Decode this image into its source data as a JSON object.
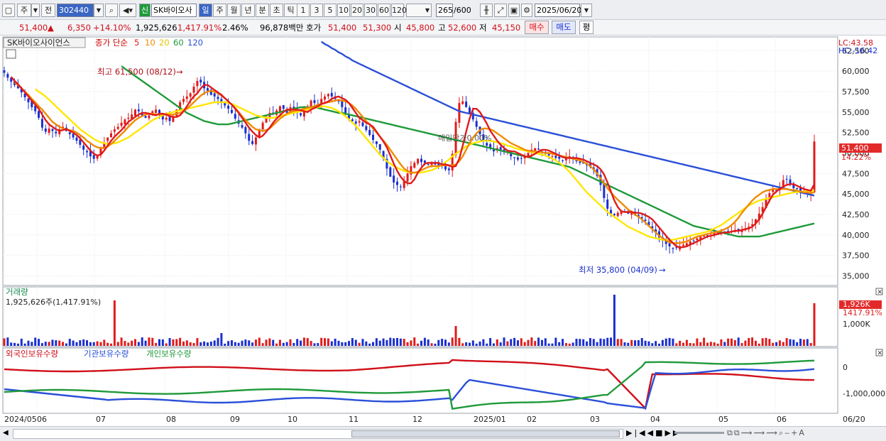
{
  "toolbar": {
    "period_unit": "주",
    "prev": "전",
    "code": "302440",
    "name": "SK바이오사",
    "new_badge": "신",
    "periods": [
      "일",
      "주",
      "월",
      "년",
      "분",
      "초",
      "틱"
    ],
    "intervals": [
      "1",
      "3",
      "5",
      "10",
      "20",
      "30",
      "60",
      "120"
    ],
    "count": "265",
    "total": "/600",
    "date": "2025/06/20"
  },
  "price_bar": {
    "price": "51,400",
    "arrow": "▲",
    "change": "6,350",
    "change_pct": "+14.10%",
    "volume": "1,925,626",
    "volume_pct": "1,417.91%",
    "turnover": "2.46%",
    "amount": "96,878백만",
    "bid_ask_label": "호가",
    "ask": "51,400",
    "bid": "51,300",
    "open_label": "시",
    "open": "45,800",
    "high_label": "고",
    "high": "52,600",
    "low_label": "저",
    "low": "45,150",
    "buy": "매수",
    "sell": "매도",
    "eval": "평"
  },
  "legend": {
    "title": "SK바이오사이언스",
    "price_label": "종가 단순",
    "ma": [
      {
        "label": "5",
        "color": "#e01b1b"
      },
      {
        "label": "10",
        "color": "#f08a00"
      },
      {
        "label": "20",
        "color": "#ffe600"
      },
      {
        "label": "60",
        "color": "#1f9a3a"
      },
      {
        "label": "120",
        "color": "#2a4fd8"
      }
    ],
    "lc": "LC:43.58",
    "hc": "HC:-16.42"
  },
  "annotations": {
    "high": "최고 61,500 (08/12)",
    "low": "최저 35,800 (04/09)",
    "mid": "매입단가0.00%"
  },
  "last_price_tag": {
    "price": "51,400",
    "pct": "14.22%"
  },
  "volume_panel": {
    "title": "거래량",
    "value": "1,925,626주(1,417.91%)",
    "tag": "1,926K",
    "tag_pct": "1417.91%",
    "tick": "1,000K"
  },
  "holdings_panel": {
    "labels": [
      "외국인보유수량",
      "기관보유수량",
      "개인보유수량"
    ],
    "colors": [
      "#d0101a",
      "#2a4fd8",
      "#1f9a3a"
    ],
    "ticks": [
      "0",
      "-1,000,000"
    ]
  },
  "x_labels": [
    "2024/05",
    "06",
    "07",
    "08",
    "09",
    "10",
    "11",
    "12",
    "2025/01",
    "02",
    "03",
    "04",
    "05",
    "06",
    "06/20"
  ],
  "chart_data": {
    "type": "candlestick",
    "title": "SK바이오사이언스",
    "ylim": [
      34000,
      64000
    ],
    "yticks": [
      35000,
      37500,
      40000,
      42500,
      45000,
      47500,
      50000,
      52500,
      55000,
      57500,
      60000,
      62500
    ],
    "closes": [
      59800,
      59200,
      58700,
      58300,
      57900,
      57400,
      56800,
      56200,
      55600,
      55100,
      54300,
      53100,
      52600,
      53000,
      52700,
      52400,
      52900,
      53200,
      52700,
      52300,
      51900,
      51500,
      51000,
      50400,
      50100,
      49600,
      49300,
      49800,
      50600,
      51300,
      51900,
      52400,
      52900,
      53200,
      53700,
      54100,
      54300,
      54700,
      55300,
      55100,
      54600,
      54300,
      54600,
      55100,
      55300,
      54600,
      54100,
      54300,
      53900,
      54400,
      55300,
      56200,
      56600,
      56900,
      57300,
      58100,
      58800,
      58600,
      57900,
      57600,
      57100,
      56900,
      56600,
      56200,
      55800,
      55400,
      54900,
      54200,
      53600,
      53100,
      52400,
      51500,
      51100,
      51900,
      52900,
      53700,
      54400,
      54900,
      54700,
      55200,
      55700,
      55400,
      54900,
      55600,
      55400,
      54900,
      54600,
      55100,
      55700,
      56400,
      56100,
      55900,
      56600,
      56900,
      57200,
      56900,
      56600,
      56300,
      55600,
      54900,
      54200,
      53900,
      53600,
      53900,
      53300,
      52800,
      52200,
      51600,
      51100,
      50400,
      49300,
      48100,
      47100,
      46400,
      46100,
      45900,
      46600,
      47500,
      48400,
      48800,
      49300,
      48900,
      48800,
      48600,
      48900,
      48600,
      48500,
      48400,
      48000,
      47900,
      49900,
      53800,
      56100,
      56300,
      55600,
      54900,
      54100,
      53200,
      52300,
      51400,
      50900,
      50600,
      50200,
      50600,
      50400,
      50100,
      50300,
      49600,
      49400,
      49200,
      49300,
      49600,
      50000,
      50400,
      50600,
      50400,
      50100,
      49900,
      49700,
      49600,
      49400,
      49300,
      49100,
      49400,
      49600,
      49300,
      49000,
      48800,
      48700,
      48500,
      48300,
      47900,
      47200,
      46100,
      44500,
      43200,
      42600,
      42400,
      42700,
      42900,
      42800,
      42600,
      42900,
      42400,
      42200,
      42000,
      41700,
      41200,
      40800,
      40300,
      39700,
      39300,
      38900,
      38600,
      38300,
      38400,
      38600,
      38800,
      39000,
      39200,
      39300,
      39600,
      39800,
      39900,
      39900,
      40000,
      40200,
      40300,
      40400,
      40300,
      40300,
      40500,
      40600,
      40500,
      40600,
      40800,
      41000,
      41300,
      41900,
      42600,
      43400,
      44300,
      45100,
      45600,
      45400,
      45800,
      46700,
      46800,
      46100,
      45700,
      45600,
      45200,
      45400,
      45000,
      45100,
      51400
    ],
    "ma5": [
      59300,
      58800,
      58400,
      57900,
      57400,
      56900,
      56400,
      55900,
      55400,
      54700,
      54000,
      53500,
      53200,
      52900,
      52700,
      52800,
      52900,
      52700,
      52500,
      52200,
      51800,
      51300,
      50800,
      50300,
      49900,
      49700,
      49800,
      50300,
      50900,
      51500,
      52000,
      52400,
      52800,
      53300,
      53800,
      54100,
      54400,
      54700,
      54900,
      54900,
      54800,
      54700,
      54600,
      54800,
      54800,
      54700,
      54500,
      54400,
      54400,
      54600,
      55100,
      55700,
      56400,
      56900,
      57300,
      57900,
      58300,
      58300,
      58000,
      57700,
      57400,
      57100,
      56700,
      56300,
      55900,
      55400,
      54900,
      54300,
      53700,
      53100,
      52600,
      52200,
      51900,
      52100,
      52600,
      53100,
      53700,
      54200,
      54600,
      55000,
      55300,
      55300,
      55300,
      55300,
      55200,
      55100,
      55000,
      55300,
      55500,
      55700,
      56000,
      56100,
      56300,
      56600,
      56800,
      56900,
      56700,
      56500,
      56100,
      55500,
      54900,
      54300,
      54000,
      53700,
      53500,
      53200,
      52600,
      52000,
      51400,
      50700,
      49700,
      48700,
      47800,
      47100,
      46600,
      46300,
      46300,
      46800,
      47600,
      48200,
      48700,
      48800,
      48800,
      48800,
      48800,
      48600,
      48600,
      48500,
      48300,
      48400,
      49300,
      50900,
      52600,
      54200,
      55400,
      55400,
      55000,
      54300,
      53600,
      52700,
      52100,
      51500,
      51000,
      50600,
      50300,
      50200,
      50200,
      50000,
      49800,
      49600,
      49500,
      49700,
      49900,
      50200,
      50400,
      50400,
      50300,
      50100,
      49900,
      49700,
      49500,
      49400,
      49400,
      49400,
      49400,
      49300,
      49200,
      49000,
      48800,
      48600,
      48400,
      48000,
      47400,
      46400,
      45300,
      44200,
      43400,
      42900,
      42800,
      42800,
      42800,
      42700,
      42700,
      42600,
      42400,
      42200,
      41900,
      41400,
      40900,
      40400,
      39900,
      39400,
      39000,
      38600,
      38500,
      38500,
      38600,
      38800,
      39000,
      39200,
      39400,
      39600,
      39800,
      39900,
      40000,
      40100,
      40200,
      40300,
      40300,
      40400,
      40500,
      40500,
      40600,
      40700,
      40800,
      41000,
      41400,
      41900,
      42600,
      43400,
      44200,
      44900,
      45300,
      45600,
      45900,
      46100,
      46200,
      46200,
      46000,
      45800,
      45600,
      45500,
      45400,
      46200
    ],
    "ma10": [
      58600,
      58300,
      57900,
      57500,
      57100,
      56600,
      56200,
      55700,
      55300,
      54800,
      54300,
      53800,
      53500,
      53200,
      53000,
      52900,
      52800,
      52700,
      52500,
      52200,
      51900,
      51500,
      51200,
      50900,
      50700,
      50600,
      50600,
      50800,
      51100,
      51500,
      51900,
      52300,
      52700,
      53200,
      53600,
      54000,
      54300,
      54500,
      54700,
      54800,
      54800,
      54700,
      54700,
      54700,
      54700,
      54700,
      54700,
      54800,
      54900,
      55100,
      55400,
      55800,
      56200,
      56600,
      57000,
      57300,
      57500,
      57600,
      57500,
      57300,
      57000,
      56700,
      56300,
      55900,
      55500,
      55000,
      54500,
      54000,
      53600,
      53200,
      52900,
      52800,
      52700,
      52800,
      53000,
      53400,
      53800,
      54200,
      54500,
      54800,
      55000,
      55100,
      55200,
      55300,
      55400,
      55500,
      55600,
      55700,
      55900,
      56000,
      56100,
      56200,
      56300,
      56400,
      56500,
      56400,
      56300,
      56100,
      55800,
      55400,
      54900,
      54400,
      53900,
      53500,
      53000,
      52500,
      52000,
      51500,
      51000,
      50400,
      49800,
      49200,
      48600,
      48100,
      47800,
      47600,
      47600,
      47700,
      47900,
      48100,
      48300,
      48400,
      48400,
      48400,
      48500,
      48500,
      48500,
      48500,
      48600,
      49000,
      49600,
      50400,
      51200,
      51900,
      52400,
      52800,
      53000,
      53000,
      52900,
      52700,
      52400,
      52100,
      51800,
      51500,
      51200,
      51000,
      50800,
      50600,
      50400,
      50300,
      50200,
      50200,
      50100,
      50100,
      50000,
      50000,
      49900,
      49800,
      49700,
      49600,
      49500,
      49400,
      49300,
      49200,
      49100,
      48900,
      48700,
      48400,
      48000,
      47500,
      46900,
      46300,
      45700,
      45200,
      44700,
      44300,
      43900,
      43500,
      43100,
      42800,
      42500,
      42200,
      41900,
      41500,
      41100,
      40700,
      40300,
      39900,
      39600,
      39300,
      39100,
      39000,
      39000,
      39000,
      39100,
      39200,
      39400,
      39600,
      39800,
      39900,
      40000,
      40100,
      40200,
      40300,
      40400,
      40500,
      40700,
      40900,
      41200,
      41600,
      42100,
      42700,
      43200,
      43700,
      44200,
      44600,
      44900,
      45200,
      45400,
      45500,
      45600,
      45600,
      45600,
      45600,
      45600,
      45500,
      45500,
      45400,
      45300,
      45200,
      45200,
      45100,
      45200
    ],
    "ma20": [
      57800,
      57500,
      57200,
      56900,
      56500,
      56100,
      55700,
      55300,
      54900,
      54500,
      54100,
      53700,
      53300,
      52900,
      52600,
      52300,
      52000,
      51700,
      51500,
      51300,
      51200,
      51100,
      51100,
      51200,
      51300,
      51500,
      51700,
      51900,
      52200,
      52500,
      52800,
      53100,
      53400,
      53700,
      54000,
      54200,
      54400,
      54600,
      54800,
      54900,
      55000,
      55100,
      55200,
      55300,
      55400,
      55500,
      55600,
      55700,
      55800,
      55900,
      56000,
      56100,
      56200,
      56200,
      56200,
      56200,
      56100,
      56000,
      55800,
      55600,
      55400,
      55200,
      55000,
      54800,
      54600,
      54500,
      54400,
      54300,
      54300,
      54300,
      54400,
      54500,
      54600,
      54700,
      54800,
      54900,
      55000,
      55100,
      55200,
      55300,
      55400,
      55500,
      55600,
      55700,
      55700,
      55600,
      55500,
      55300,
      55100,
      54800,
      54500,
      54100,
      53700,
      53300,
      52800,
      52300,
      51800,
      51300,
      50800,
      50300,
      49800,
      49400,
      49000,
      48700,
      48400,
      48200,
      48000,
      47800,
      47700,
      47600,
      47600,
      47600,
      47600,
      47700,
      47800,
      47900,
      48100,
      48300,
      48600,
      48900,
      49200,
      49600,
      49900,
      50200,
      50500,
      50800,
      51000,
      51200,
      51300,
      51400,
      51500,
      51500,
      51500,
      51400,
      51300,
      51200,
      51100,
      50900,
      50800,
      50600,
      50500,
      50400,
      50300,
      50200,
      50100,
      50000,
      49900,
      49800,
      49700,
      49500,
      49300,
      49100,
      48800,
      48500,
      48100,
      47700,
      47200,
      46700,
      46200,
      45700,
      45200,
      44800,
      44400,
      44000,
      43600,
      43200,
      42800,
      42500,
      42200,
      41900,
      41600,
      41300,
      41000,
      40800,
      40600,
      40400,
      40200,
      40000,
      39800,
      39700,
      39600,
      39500,
      39400,
      39400,
      39400,
      39400,
      39500,
      39600,
      39700,
      39800,
      39900,
      40000,
      40100,
      40200,
      40300,
      40400,
      40600,
      40800,
      41000,
      41200,
      41500,
      41800,
      42100,
      42400,
      42700,
      43000,
      43300,
      43600,
      43800,
      44000,
      44200,
      44300,
      44400,
      44500,
      44600,
      44700,
      44800,
      44900,
      45000,
      45100,
      45200,
      45200,
      45300,
      45300,
      45300,
      45400,
      45400
    ],
    "ma60": [
      60600,
      60300,
      60000,
      59700,
      59400,
      59100,
      58800,
      58500,
      58200,
      57900,
      57600,
      57300,
      57000,
      56700,
      56400,
      56100,
      55800,
      55500,
      55200,
      54900,
      54700,
      54500,
      54300,
      54100,
      53900,
      53800,
      53700,
      53600,
      53500,
      53500,
      53500,
      53500,
      53600,
      53700,
      53800,
      53900,
      54000,
      54100,
      54200,
      54300,
      54400,
      54500,
      54600,
      54700,
      54800,
      54900,
      55000,
      55100,
      55200,
      55300,
      55400,
      55500,
      55600,
      55600,
      55600,
      55600,
      55600,
      55500,
      55400,
      55300,
      55200,
      55100,
      55000,
      54900,
      54900,
      54800,
      54700,
      54600,
      54500,
      54400,
      54300,
      54200,
      54100,
      54000,
      53900,
      53800,
      53700,
      53600,
      53500,
      53400,
      53300,
      53200,
      53100,
      53000,
      52900,
      52800,
      52700,
      52600,
      52500,
      52400,
      52300,
      52200,
      52100,
      52000,
      51900,
      51800,
      51700,
      51600,
      51500,
      51400,
      51300,
      51200,
      51100,
      51000,
      50900,
      50800,
      50700,
      50600,
      50500,
      50400,
      50300,
      50200,
      50100,
      50000,
      49900,
      49800,
      49700,
      49600,
      49500,
      49400,
      49300,
      49200,
      49100,
      49000,
      48900,
      48800,
      48700,
      48600,
      48500,
      48400,
      48300,
      48100,
      47900,
      47700,
      47500,
      47300,
      47100,
      46900,
      46700,
      46500,
      46300,
      46100,
      45900,
      45700,
      45500,
      45300,
      45100,
      44900,
      44700,
      44500,
      44300,
      44100,
      43900,
      43700,
      43500,
      43300,
      43100,
      42900,
      42700,
      42500,
      42300,
      42100,
      41900,
      41700,
      41500,
      41300,
      41100,
      41000,
      40900,
      40800,
      40700,
      40600,
      40500,
      40400,
      40300,
      40200,
      40100,
      40000,
      39900,
      39800,
      39800,
      39800,
      39800,
      39800,
      39800,
      39800,
      39900,
      40000,
      40100,
      40200,
      40300,
      40400,
      40500,
      40600,
      40700,
      40800,
      40900,
      41000,
      41100,
      41200,
      41300,
      41400
    ],
    "ma120": [
      63600,
      63300,
      63100,
      62800,
      62600,
      62300,
      62100,
      61800,
      61600,
      61300,
      61100,
      60900,
      60700,
      60500,
      60300,
      60100,
      59900,
      59700,
      59500,
      59300,
      59100,
      58900,
      58700,
      58500,
      58300,
      58100,
      57900,
      57700,
      57500,
      57300,
      57100,
      56900,
      56700,
      56500,
      56300,
      56100,
      55900,
      55700,
      55500,
      55300,
      55100,
      55000,
      54900,
      54800,
      54700,
      54600,
      54500,
      54400,
      54300,
      54200,
      54100,
      54000,
      53900,
      53800,
      53700,
      53600,
      53500,
      53400,
      53300,
      53200,
      53100,
      53000,
      52900,
      52800,
      52700,
      52600,
      52500,
      52400,
      52300,
      52200,
      52100,
      52000,
      51900,
      51800,
      51700,
      51600,
      51500,
      51400,
      51300,
      51200,
      51100,
      51000,
      50900,
      50800,
      50700,
      50600,
      50500,
      50400,
      50300,
      50200,
      50100,
      50000,
      49900,
      49800,
      49700,
      49600,
      49500,
      49400,
      49300,
      49200,
      49100,
      49000,
      48900,
      48800,
      48700,
      48600,
      48500,
      48400,
      48300,
      48200,
      48100,
      48000,
      47900,
      47800,
      47700,
      47600,
      47500,
      47400,
      47300,
      47200,
      47100,
      47000,
      46900,
      46800,
      46700,
      46600,
      46500,
      46400,
      46300,
      46200,
      46100,
      46000,
      45900,
      45800,
      45700,
      45600,
      45500,
      45400,
      45300,
      45200,
      45100,
      45000,
      44900,
      44800
    ]
  }
}
